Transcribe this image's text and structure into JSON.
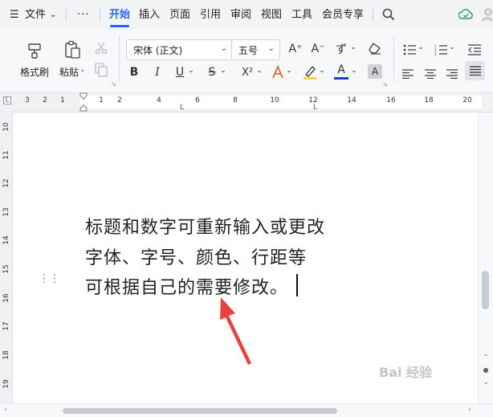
{
  "menubar": {
    "file_menu": "文件",
    "more": "···",
    "tabs": [
      "开始",
      "插入",
      "页面",
      "引用",
      "审阅",
      "视图",
      "工具",
      "会员专享"
    ],
    "active_tab": "开始"
  },
  "ribbon": {
    "format_painter": "格式刷",
    "paste": "粘贴",
    "font_name": "宋体 (正文)",
    "font_size": "五号",
    "bold": "B",
    "italic": "I",
    "underline": "U",
    "strikethrough": "S",
    "superscript": "X²",
    "increase_font": "A⁺",
    "decrease_font": "A⁻",
    "phonetic": "ず",
    "font_color_letter": "A",
    "char_shading": "A",
    "font_color_hex": "#1741d6"
  },
  "ruler": {
    "left_numbers": [
      "3",
      "2",
      "1"
    ],
    "right_numbers": [
      "1",
      "2",
      "4",
      "6",
      "8",
      "10",
      "12",
      "14",
      "16",
      "18",
      "20"
    ],
    "vertical_numbers": [
      "10",
      "11",
      "12",
      "13",
      "14",
      "15",
      "16",
      "17",
      "18",
      "19"
    ]
  },
  "document": {
    "lines": [
      "标题和数字可重新输入或更改",
      "字体、字号、颜色、行距等",
      "可根据自己的需要修改。"
    ]
  },
  "colors": {
    "accent": "#2867f5",
    "annotation_arrow": "#e8423a"
  },
  "icons": {
    "menu": "hamburger-menu-icon",
    "search": "search-icon",
    "cloud": "cloud-sync-icon",
    "scissors": "cut-icon",
    "eraser": "clear-format-icon"
  },
  "watermark": "Bai 经验"
}
